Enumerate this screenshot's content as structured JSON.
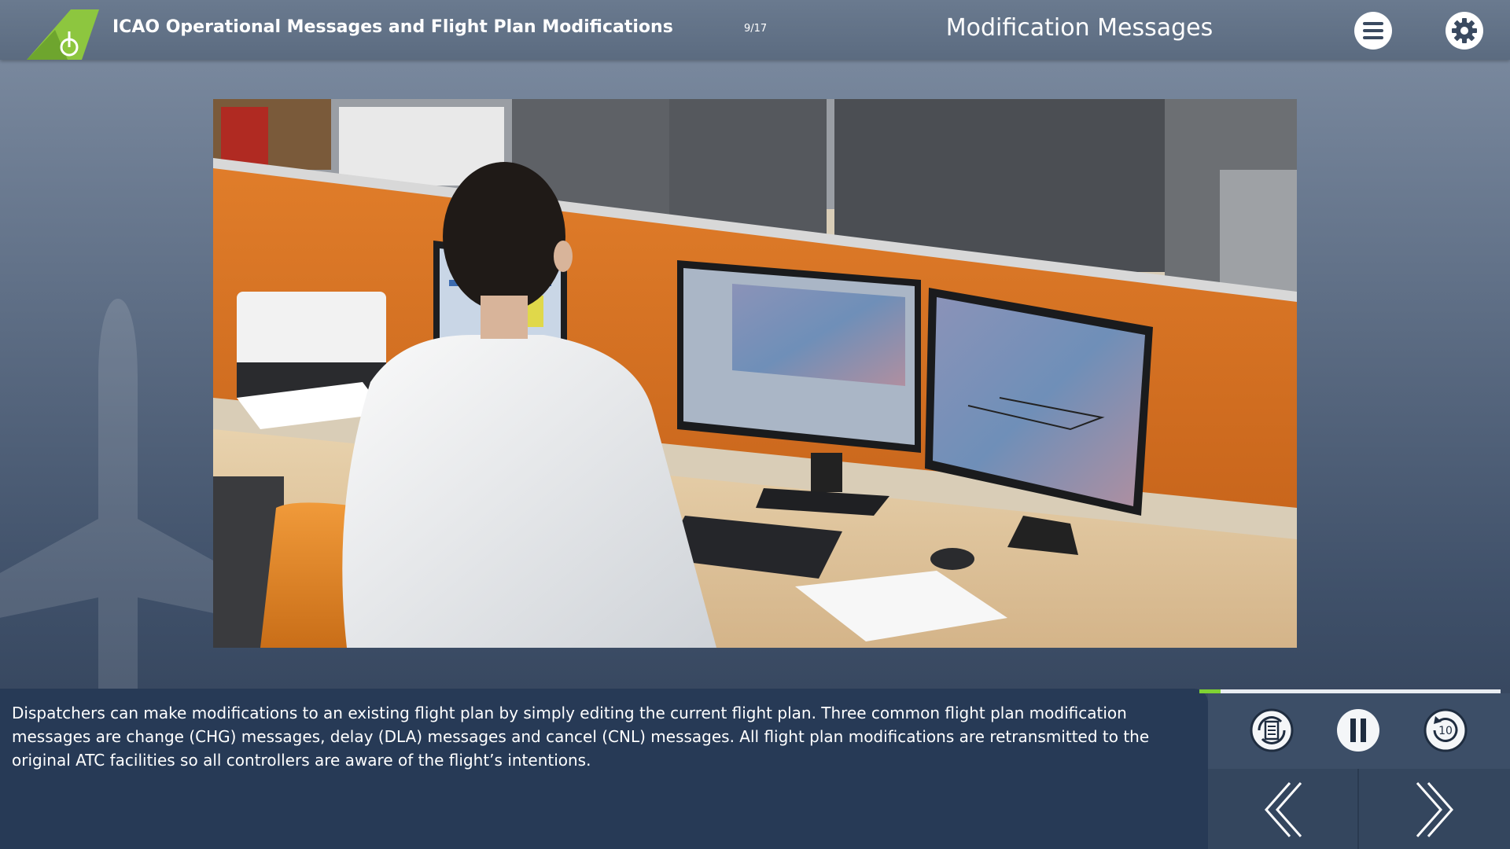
{
  "header": {
    "course_title": "ICAO Operational Messages and Flight Plan Modifications",
    "page_counter": "9/17",
    "screen_title": "Modification Messages",
    "menu_icon": "hamburger-menu-icon",
    "settings_icon": "gear-icon"
  },
  "caption": {
    "text": "Dispatchers can make modifications to an existing flight plan by simply editing the current flight plan. Three common flight plan modification messages are change (CHG) messages, delay (DLA) messages and cancel (CNL) messages. All flight plan modifications are retransmitted to the original ATC facilities so all controllers are aware of the flight’s intentions."
  },
  "player": {
    "progress": 0.07,
    "transcript_icon": "transcript-icon",
    "pause_icon": "pause-icon",
    "replay_icon": "replay-10-icon",
    "prev_icon": "chevron-left-icon",
    "next_icon": "chevron-right-icon"
  },
  "colors": {
    "accent_green": "#7fd233",
    "logo_green": "#8dc63f",
    "caption_bg": "#273a56",
    "header_bg": "#5b6b80"
  }
}
